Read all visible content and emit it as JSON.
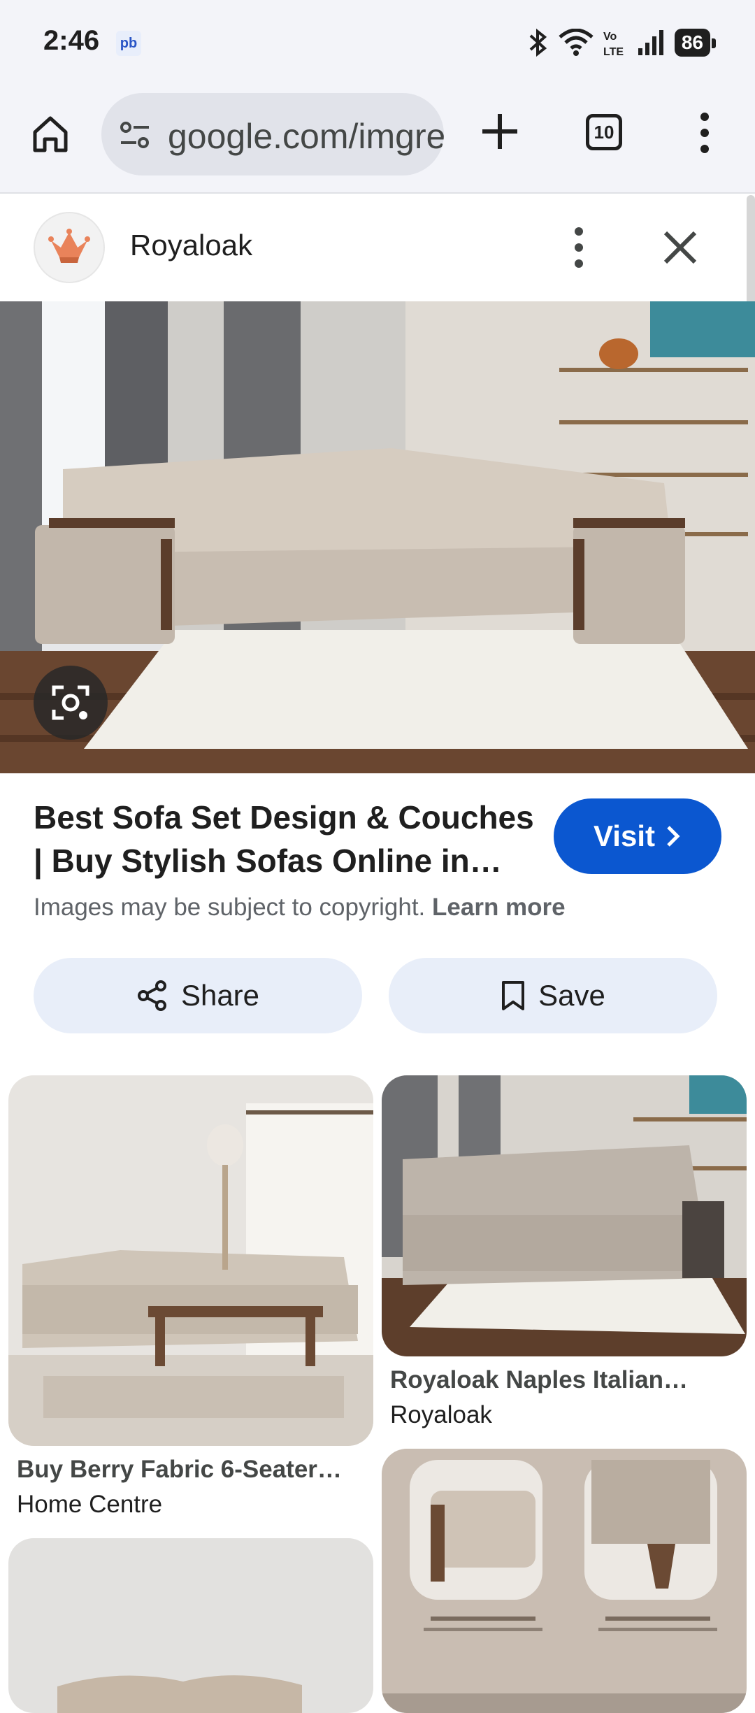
{
  "status_bar": {
    "time": "2:46",
    "notification_badge": "pb",
    "battery": "86",
    "icons": [
      "bluetooth-icon",
      "wifi-icon",
      "volte-icon",
      "signal-icon",
      "battery-icon"
    ]
  },
  "browser": {
    "url": "google.com/imgres",
    "tabs_count": "10"
  },
  "panel": {
    "site_name": "Royaloak"
  },
  "result": {
    "title": "Best Sofa Set Design & Couches | Buy Stylish Sofas Online in…",
    "visit_label": "Visit",
    "copyright_text": "Images may be subject to copyright.",
    "learn_more": "Learn more",
    "share_label": "Share",
    "save_label": "Save"
  },
  "related": [
    {
      "title": "Buy Berry Fabric 6-Seater…",
      "source": "Home Centre"
    },
    {
      "title": "Royaloak Naples Italian…",
      "source": "Royaloak"
    }
  ],
  "colors": {
    "accent": "#0b57d0",
    "chrome_bg": "#f3f4f9",
    "chip_bg": "#e8eef9"
  }
}
